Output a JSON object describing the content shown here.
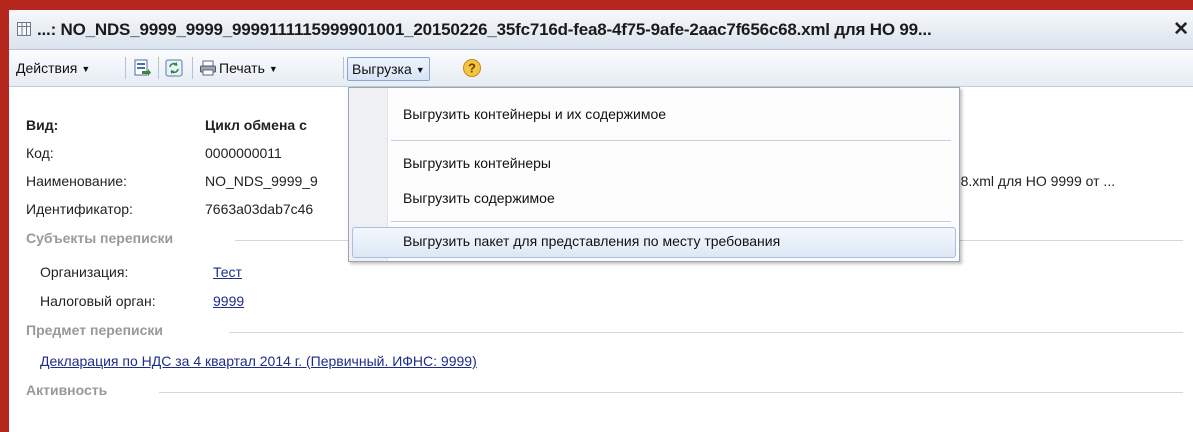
{
  "title": "...: NO_NDS_9999_9999_9999111115999901001_20150226_35fc716d-fea8-4f75-9afe-2aac7f656c68.xml для НО 99...",
  "toolbar": {
    "actions": "Действия",
    "print": "Печать",
    "export": "Выгрузка",
    "help": "?"
  },
  "export_menu": {
    "item1": "Выгрузить контейнеры и их содержимое",
    "item2": "Выгрузить контейнеры",
    "item3": "Выгрузить содержимое",
    "item4": "Выгрузить пакет для представления по месту требования"
  },
  "fields": {
    "vid_label": "Вид:",
    "vid_value": "Цикл обмена с",
    "kod_label": "Код:",
    "kod_value": "0000000011",
    "name_label": "Наименование:",
    "name_value_left": "NO_NDS_9999_9",
    "name_value_right": "6c68.xml для НО 9999 от ...",
    "id_label": "Идентификатор:",
    "id_value": "7663a03dab7c46"
  },
  "subjects": {
    "heading": "Субъекты переписки",
    "org_label": "Организация:",
    "org_value": "Тест",
    "tax_label": "Налоговый орган:",
    "tax_value": "9999"
  },
  "subject_matter": {
    "heading": "Предмет переписки",
    "link": "Декларация по НДС за 4 квартал 2014 г. (Первичный. ИФНС: 9999)"
  },
  "activity": {
    "heading": "Активность"
  }
}
